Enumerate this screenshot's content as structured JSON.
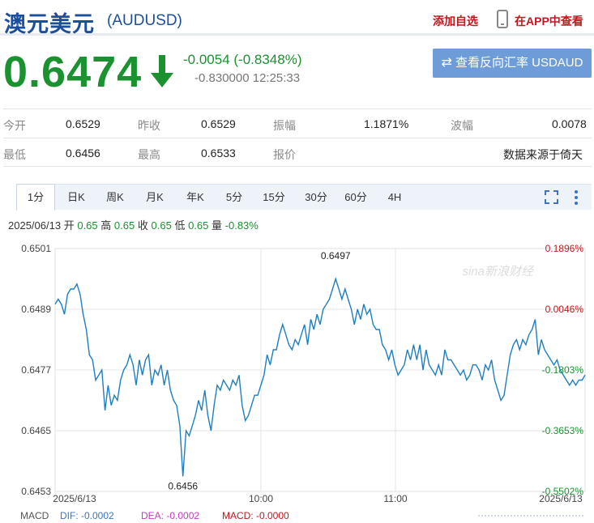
{
  "header": {
    "title": "澳元美元",
    "code": "(AUDUSD)",
    "add_fav": "添加自选",
    "open_app": "在APP中查看"
  },
  "quote": {
    "price": "0.6474",
    "change": "-0.0054 (-0.8348%)",
    "subinfo": "-0.830000 12:25:33",
    "reverse_button": "查看反向汇率 USDAUD",
    "direction": "down"
  },
  "stats": {
    "row1": [
      {
        "label": "今开",
        "value": "0.6529"
      },
      {
        "label": "昨收",
        "value": "0.6529"
      },
      {
        "label": "振幅",
        "value": "1.1871%"
      },
      {
        "label": "波幅",
        "value": "0.0078"
      }
    ],
    "row2": [
      {
        "label": "最低",
        "value": "0.6456"
      },
      {
        "label": "最高",
        "value": "0.6533"
      },
      {
        "label": "报价",
        "value": "数据来源于倚天"
      }
    ]
  },
  "tabs": [
    "1分",
    "日K",
    "周K",
    "月K",
    "年K",
    "5分",
    "15分",
    "30分",
    "60分",
    "4H"
  ],
  "active_tab": "1分",
  "quote_line": {
    "date": "2025/06/13",
    "open_label": "开",
    "open": "0.65",
    "high_label": "高",
    "high": "0.65",
    "close_label": "收",
    "close": "0.65",
    "low_label": "低",
    "low": "0.65",
    "vol_label": "量",
    "vol": "-0.83%"
  },
  "colors": {
    "line": "#1e7fc0",
    "up": "#c4161c",
    "down": "#1a9230",
    "brand": "#1b4f9c"
  },
  "chart_data": {
    "type": "line",
    "x_ticks": [
      "2025/6/13",
      "10:00",
      "11:00",
      "2025/6/13"
    ],
    "y_ticks_left": [
      "0.6501",
      "0.6489",
      "0.6477",
      "0.6465",
      "0.6453"
    ],
    "y_ticks_right": [
      "0.1896%",
      "0.0046%",
      "-0.1803%",
      "-0.3653%",
      "-0.5502%"
    ],
    "ylim": [
      0.6453,
      0.6501
    ],
    "annotations": [
      {
        "text": "0.6497",
        "index": 90,
        "value": 0.6497
      },
      {
        "text": "0.6456",
        "index": 41,
        "value": 0.6456
      }
    ],
    "watermark": "sina新浪财经",
    "series": [
      {
        "values": [
          0.649,
          0.6491,
          0.649,
          0.6488,
          0.6492,
          0.6493,
          0.6493,
          0.6494,
          0.6492,
          0.6488,
          0.6485,
          0.648,
          0.6479,
          0.6475,
          0.6476,
          0.6477,
          0.6469,
          0.6474,
          0.647,
          0.6472,
          0.6471,
          0.6475,
          0.6477,
          0.6478,
          0.648,
          0.6478,
          0.6474,
          0.6479,
          0.6476,
          0.6479,
          0.648,
          0.6474,
          0.6477,
          0.6476,
          0.6478,
          0.6474,
          0.6477,
          0.6473,
          0.6471,
          0.647,
          0.6466,
          0.6456,
          0.6465,
          0.6464,
          0.6466,
          0.6468,
          0.6471,
          0.6469,
          0.6473,
          0.6468,
          0.6465,
          0.647,
          0.6474,
          0.6473,
          0.6475,
          0.6474,
          0.6473,
          0.6475,
          0.6474,
          0.6476,
          0.647,
          0.6467,
          0.6468,
          0.647,
          0.6472,
          0.6472,
          0.6474,
          0.6476,
          0.648,
          0.6478,
          0.6481,
          0.6481,
          0.6484,
          0.6486,
          0.6484,
          0.6482,
          0.6481,
          0.6483,
          0.6482,
          0.6484,
          0.6486,
          0.6482,
          0.6487,
          0.6485,
          0.6488,
          0.6486,
          0.6489,
          0.649,
          0.6491,
          0.6493,
          0.6495,
          0.6493,
          0.6491,
          0.6493,
          0.6491,
          0.6489,
          0.6486,
          0.6489,
          0.6487,
          0.649,
          0.6488,
          0.6489,
          0.6486,
          0.6485,
          0.6485,
          0.6482,
          0.6481,
          0.6479,
          0.6481,
          0.6478,
          0.6476,
          0.6477,
          0.6478,
          0.6481,
          0.6479,
          0.6482,
          0.6479,
          0.6482,
          0.6477,
          0.6481,
          0.6478,
          0.6477,
          0.6476,
          0.6478,
          0.6476,
          0.6481,
          0.6479,
          0.6479,
          0.6478,
          0.6477,
          0.6476,
          0.6477,
          0.6475,
          0.6476,
          0.6478,
          0.6478,
          0.6477,
          0.6475,
          0.6478,
          0.6477,
          0.6479,
          0.6475,
          0.6473,
          0.6471,
          0.6472,
          0.6476,
          0.648,
          0.6482,
          0.6483,
          0.6481,
          0.6483,
          0.6482,
          0.6484,
          0.6485,
          0.6487,
          0.648,
          0.6483,
          0.6481,
          0.648,
          0.6479,
          0.6478,
          0.6479,
          0.6477,
          0.6476,
          0.6475,
          0.6474,
          0.6475,
          0.6474,
          0.6475,
          0.6475,
          0.6476
        ]
      }
    ]
  },
  "macd": {
    "label": "MACD",
    "dif": "DIF: -0.0002",
    "dea": "DEA: -0.0002",
    "macd": "MACD: -0.0000"
  }
}
